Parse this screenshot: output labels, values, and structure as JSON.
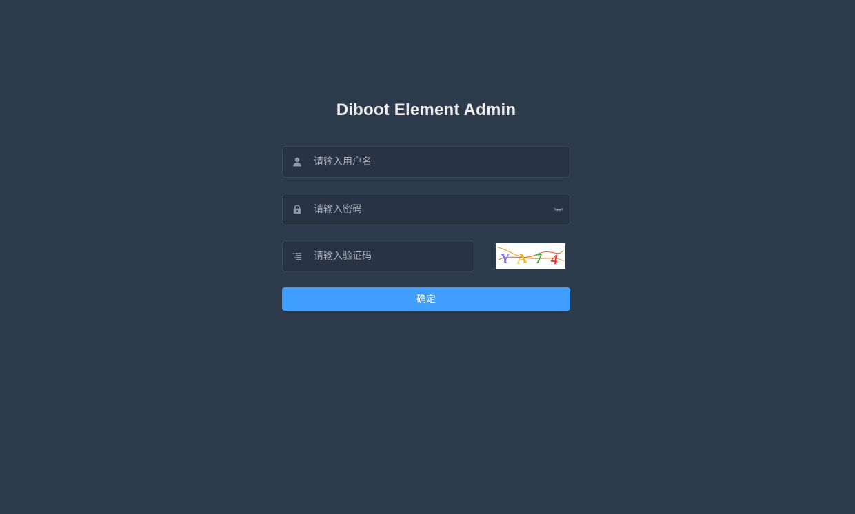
{
  "login": {
    "title": "Diboot Element Admin",
    "username": {
      "placeholder": "请输入用户名",
      "value": "",
      "icon": "user-icon"
    },
    "password": {
      "placeholder": "请输入密码",
      "value": "",
      "icon": "lock-icon",
      "toggle_icon": "eye-closed-icon"
    },
    "captcha": {
      "placeholder": "请输入验证码",
      "value": "",
      "icon": "list-icon",
      "image_text": "YA74"
    },
    "submit_label": "确定",
    "colors": {
      "background": "#2d3a4b",
      "primary": "#409eff",
      "title": "#eeeeee",
      "icon": "#889aa4"
    }
  }
}
